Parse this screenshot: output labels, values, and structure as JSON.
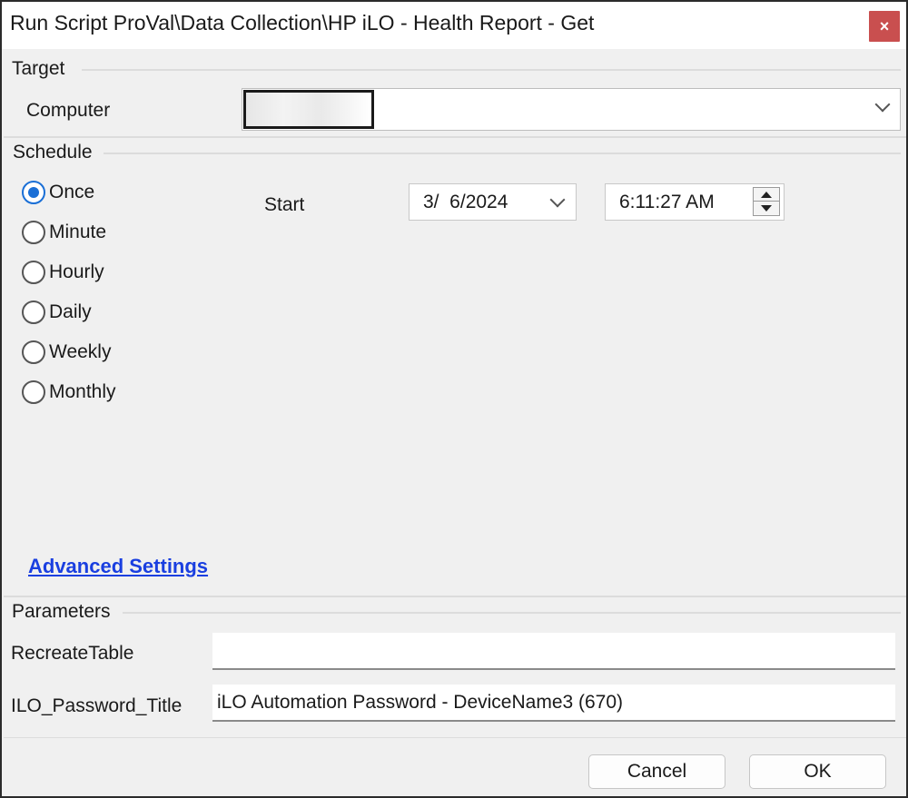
{
  "window": {
    "title": "Run Script ProVal\\Data Collection\\HP iLO - Health Report - Get",
    "close_glyph": "×"
  },
  "target": {
    "section_label": "Target",
    "computer_label": "Computer",
    "computer_value": ""
  },
  "schedule": {
    "section_label": "Schedule",
    "options": [
      {
        "label": "Once",
        "checked": true
      },
      {
        "label": "Minute",
        "checked": false
      },
      {
        "label": "Hourly",
        "checked": false
      },
      {
        "label": "Daily",
        "checked": false
      },
      {
        "label": "Weekly",
        "checked": false
      },
      {
        "label": "Monthly",
        "checked": false
      }
    ],
    "start_label": "Start",
    "start_date": "3/  6/2024",
    "start_time": "6:11:27 AM",
    "advanced_settings": "Advanced Settings"
  },
  "parameters": {
    "section_label": "Parameters",
    "recreate_table_label": "RecreateTable",
    "recreate_table_value": "",
    "ilo_password_title_label": "ILO_Password_Title",
    "ilo_password_title_value": "iLO Automation Password - DeviceName3 (670)"
  },
  "buttons": {
    "cancel": "Cancel",
    "ok": "OK"
  },
  "colors": {
    "close_bg": "#c94f4f",
    "radio_checked": "#1a6fd6",
    "link": "#1a3fe0"
  }
}
